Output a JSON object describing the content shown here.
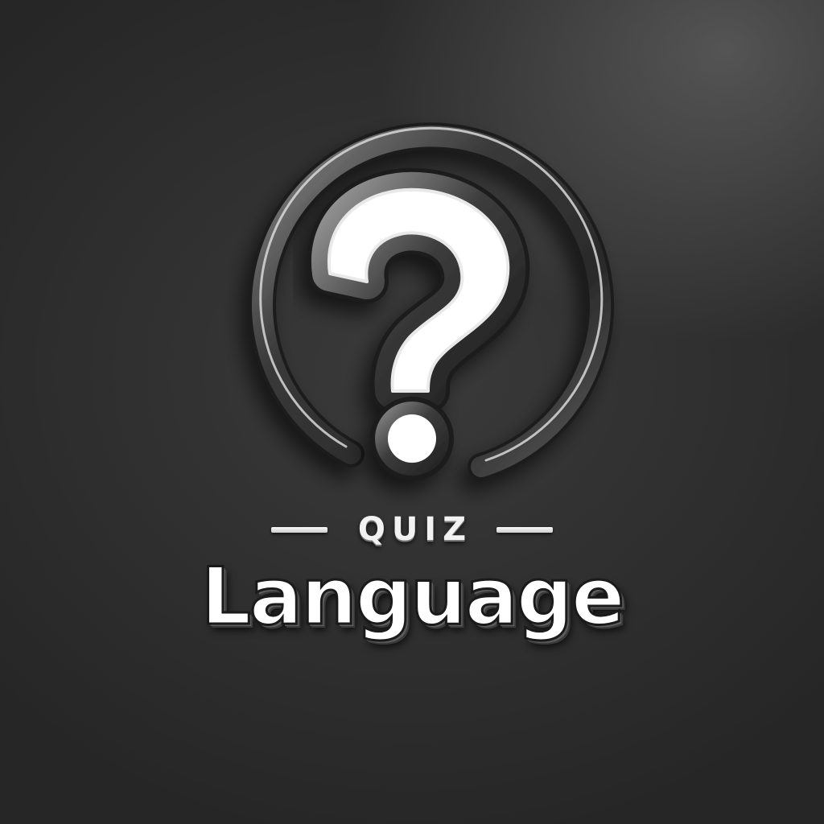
{
  "logo": {
    "icon": "question-mark-icon",
    "eyebrow": "QUIZ",
    "title": "Language"
  },
  "colors": {
    "background": "#2e2e2e",
    "ring": "#3b3b3b",
    "ring_highlight": "#cfcfcf",
    "glyph_fill": "#ffffff",
    "text": "#ffffff"
  }
}
